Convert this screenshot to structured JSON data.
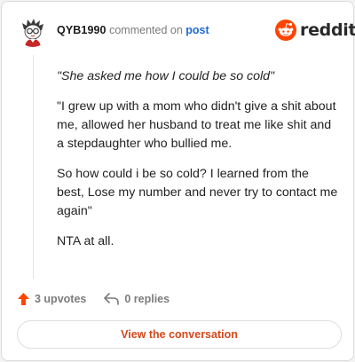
{
  "header": {
    "username": "QYB1990",
    "action_text": "commented on",
    "post_link": "post",
    "brand_name": "reddit",
    "avatar_icon": "cartoon-avatar-icon",
    "brand_icon": "reddit-logo-icon"
  },
  "comment": {
    "paragraphs": [
      "\"She asked me how I could be so cold\"",
      "\"I grew up with a mom who didn't give a shit about me, allowed her husband to treat me like shit and a stepdaughter who bullied me.",
      "So how could i be so cold? I learned from the best, Lose my number and never try to contact me again\"",
      "NTA at all."
    ]
  },
  "footer": {
    "upvotes": "3 upvotes",
    "replies": "0 replies",
    "cta_label": "View the conversation",
    "upvote_icon": "upvote-arrow-icon",
    "reply_icon": "reply-arrow-icon"
  },
  "colors": {
    "brand_orange": "#ff4500",
    "cta_text": "#d4481c",
    "link_blue": "#1c6bd6",
    "muted_gray": "#7c7c7c"
  }
}
